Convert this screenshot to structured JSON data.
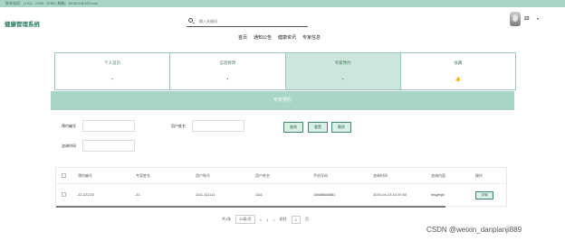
{
  "topbar": {
    "contact": "联系电话：(+01) - 2345 - 6789 | 邮箱：801602@163.com"
  },
  "header": {
    "brand": "健康管理系统",
    "search_placeholder": "输入关键词",
    "username": "22",
    "caret": "▾"
  },
  "nav": [
    "首页",
    "通知公告",
    "健康资讯",
    "专家信息"
  ],
  "cards": [
    {
      "label": "个人首页",
      "icon": "home-icon",
      "glyph": "▪",
      "active": false
    },
    {
      "label": "信息修改",
      "icon": "edit-icon",
      "glyph": "▪",
      "active": false
    },
    {
      "label": "专家预约",
      "icon": "calendar-icon",
      "glyph": "▪",
      "active": true
    },
    {
      "label": "收藏",
      "icon": "thumb-up-icon",
      "glyph": "👍",
      "active": false
    }
  ],
  "section_title": "专家预约",
  "filters": {
    "f1_label": "预约编号",
    "f2_label": "用户姓名",
    "f3_label": "咨询时间",
    "search_btn": "查询",
    "reset_btn": "重置",
    "delete_btn": "删除"
  },
  "table": {
    "headers": [
      "预约编号",
      "专家姓名",
      "用户账号",
      "用户姓名",
      "手机号码",
      "咨询时间",
      "咨询内容",
      "操作"
    ],
    "rows": [
      {
        "cells": [
          "22-2222/2",
          "22",
          "1111-111111",
          "1111",
          "18888888881",
          "2024-04-23 10:37:00",
          "fdsgfhjkl"
        ],
        "action": "详情"
      }
    ]
  },
  "pager": {
    "total": "共1条",
    "page_size": "10条/页",
    "prev": "<",
    "current": "1",
    "next": ">",
    "goto_label": "前往",
    "goto_value": "1",
    "page_suffix": "页"
  },
  "watermark": "CSDN @weixin_danpianji889"
}
